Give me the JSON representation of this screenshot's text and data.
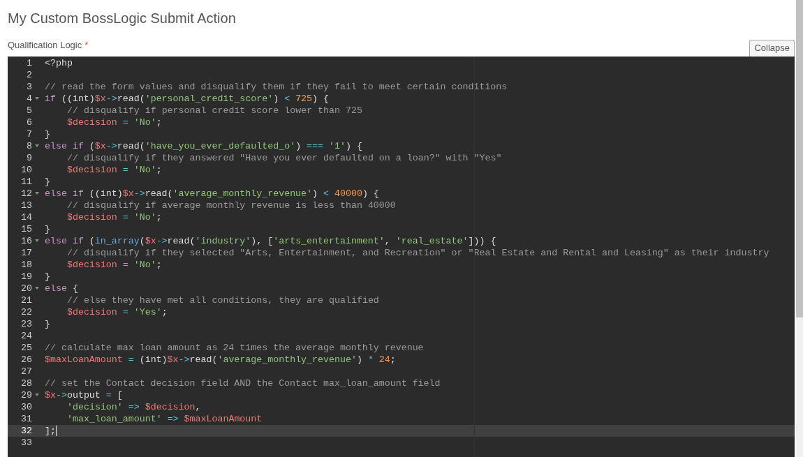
{
  "page_title": "My Custom BossLogic Submit Action",
  "field": {
    "label": "Qualification Logic",
    "required_mark": "*",
    "collapse_button": "Collapse"
  },
  "editor": {
    "lines": [
      {
        "number": "1",
        "foldable": false,
        "selected": false,
        "indent": false,
        "tokens": [
          {
            "kind": "plain",
            "text": "<?php"
          }
        ]
      },
      {
        "number": "2",
        "foldable": false,
        "selected": false,
        "indent": false
      },
      {
        "number": "3",
        "foldable": false,
        "selected": false,
        "indent": false,
        "tokens": [
          {
            "kind": "comment",
            "text": "// read the form values and disqualify them if they fail to meet certain conditions"
          }
        ]
      },
      {
        "number": "4",
        "foldable": true,
        "selected": false,
        "indent": false,
        "tokens": [
          {
            "kind": "keyword",
            "text": "if"
          },
          {
            "kind": "plain",
            "text": " ((int)"
          },
          {
            "kind": "variable",
            "text": "$x"
          },
          {
            "kind": "operator",
            "text": "->"
          },
          {
            "kind": "plain",
            "text": "read("
          },
          {
            "kind": "string",
            "text": "'personal_credit_score'"
          },
          {
            "kind": "plain",
            "text": ") "
          },
          {
            "kind": "operator",
            "text": "< "
          },
          {
            "kind": "number",
            "text": "725"
          },
          {
            "kind": "plain",
            "text": ") {"
          }
        ]
      },
      {
        "number": "5",
        "foldable": false,
        "selected": false,
        "indent": true,
        "tokens": [
          {
            "kind": "comment",
            "text": "// disqualify if personal credit score lower than 725"
          }
        ]
      },
      {
        "number": "6",
        "foldable": false,
        "selected": false,
        "indent": true,
        "tokens": [
          {
            "kind": "variable",
            "text": "$decision"
          },
          {
            "kind": "operator",
            "text": " = "
          },
          {
            "kind": "string",
            "text": "'No'"
          },
          {
            "kind": "plain",
            "text": ";"
          }
        ]
      },
      {
        "number": "7",
        "foldable": false,
        "selected": false,
        "indent": false,
        "tokens": [
          {
            "kind": "plain",
            "text": "}"
          }
        ]
      },
      {
        "number": "8",
        "foldable": true,
        "selected": false,
        "indent": false,
        "tokens": [
          {
            "kind": "keyword",
            "text": "else if"
          },
          {
            "kind": "plain",
            "text": " ("
          },
          {
            "kind": "variable",
            "text": "$x"
          },
          {
            "kind": "operator",
            "text": "->"
          },
          {
            "kind": "plain",
            "text": "read("
          },
          {
            "kind": "string",
            "text": "'have_you_ever_defaulted_o'"
          },
          {
            "kind": "plain",
            "text": ") "
          },
          {
            "kind": "operator",
            "text": "=== "
          },
          {
            "kind": "string",
            "text": "'1'"
          },
          {
            "kind": "plain",
            "text": ") {"
          }
        ]
      },
      {
        "number": "9",
        "foldable": false,
        "selected": false,
        "indent": true,
        "tokens": [
          {
            "kind": "comment",
            "text": "// disqualify if they answered \"Have you ever defaulted on a loan?\" with \"Yes\""
          }
        ]
      },
      {
        "number": "10",
        "foldable": false,
        "selected": false,
        "indent": true,
        "tokens": [
          {
            "kind": "variable",
            "text": "$decision"
          },
          {
            "kind": "operator",
            "text": " = "
          },
          {
            "kind": "string",
            "text": "'No'"
          },
          {
            "kind": "plain",
            "text": ";"
          }
        ]
      },
      {
        "number": "11",
        "foldable": false,
        "selected": false,
        "indent": false,
        "tokens": [
          {
            "kind": "plain",
            "text": "}"
          }
        ]
      },
      {
        "number": "12",
        "foldable": true,
        "selected": false,
        "indent": false,
        "tokens": [
          {
            "kind": "keyword",
            "text": "else if"
          },
          {
            "kind": "plain",
            "text": " ((int)"
          },
          {
            "kind": "variable",
            "text": "$x"
          },
          {
            "kind": "operator",
            "text": "->"
          },
          {
            "kind": "plain",
            "text": "read("
          },
          {
            "kind": "string",
            "text": "'average_monthly_revenue'"
          },
          {
            "kind": "plain",
            "text": ") "
          },
          {
            "kind": "operator",
            "text": "< "
          },
          {
            "kind": "number",
            "text": "40000"
          },
          {
            "kind": "plain",
            "text": ") {"
          }
        ]
      },
      {
        "number": "13",
        "foldable": false,
        "selected": false,
        "indent": true,
        "tokens": [
          {
            "kind": "comment",
            "text": "// disqualify if average monthly revenue is less than 40000"
          }
        ]
      },
      {
        "number": "14",
        "foldable": false,
        "selected": false,
        "indent": true,
        "tokens": [
          {
            "kind": "variable",
            "text": "$decision"
          },
          {
            "kind": "operator",
            "text": " = "
          },
          {
            "kind": "string",
            "text": "'No'"
          },
          {
            "kind": "plain",
            "text": ";"
          }
        ]
      },
      {
        "number": "15",
        "foldable": false,
        "selected": false,
        "indent": false,
        "tokens": [
          {
            "kind": "plain",
            "text": "}"
          }
        ]
      },
      {
        "number": "16",
        "foldable": true,
        "selected": false,
        "indent": false,
        "tokens": [
          {
            "kind": "keyword",
            "text": "else if"
          },
          {
            "kind": "plain",
            "text": " ("
          },
          {
            "kind": "function",
            "text": "in_array"
          },
          {
            "kind": "plain",
            "text": "("
          },
          {
            "kind": "variable",
            "text": "$x"
          },
          {
            "kind": "operator",
            "text": "->"
          },
          {
            "kind": "plain",
            "text": "read("
          },
          {
            "kind": "string",
            "text": "'industry'"
          },
          {
            "kind": "plain",
            "text": "), ["
          },
          {
            "kind": "string",
            "text": "'arts_entertainment'"
          },
          {
            "kind": "plain",
            "text": ", "
          },
          {
            "kind": "string",
            "text": "'real_estate'"
          },
          {
            "kind": "plain",
            "text": "])) {"
          }
        ]
      },
      {
        "number": "17",
        "foldable": false,
        "selected": false,
        "indent": true,
        "tokens": [
          {
            "kind": "comment",
            "text": "// disqualify if they selected \"Arts, Entertainment, and Recreation\" or \"Real Estate and Rental and Leasing\" as their industry"
          }
        ]
      },
      {
        "number": "18",
        "foldable": false,
        "selected": false,
        "indent": true,
        "tokens": [
          {
            "kind": "variable",
            "text": "$decision"
          },
          {
            "kind": "operator",
            "text": " = "
          },
          {
            "kind": "string",
            "text": "'No'"
          },
          {
            "kind": "plain",
            "text": ";"
          }
        ]
      },
      {
        "number": "19",
        "foldable": false,
        "selected": false,
        "indent": false,
        "tokens": [
          {
            "kind": "plain",
            "text": "}"
          }
        ]
      },
      {
        "number": "20",
        "foldable": true,
        "selected": false,
        "indent": false,
        "tokens": [
          {
            "kind": "keyword",
            "text": "else"
          },
          {
            "kind": "plain",
            "text": " {"
          }
        ]
      },
      {
        "number": "21",
        "foldable": false,
        "selected": false,
        "indent": true,
        "tokens": [
          {
            "kind": "comment",
            "text": "// else they have met all conditions, they are qualified"
          }
        ]
      },
      {
        "number": "22",
        "foldable": false,
        "selected": false,
        "indent": true,
        "tokens": [
          {
            "kind": "variable",
            "text": "$decision"
          },
          {
            "kind": "operator",
            "text": " = "
          },
          {
            "kind": "string",
            "text": "'Yes'"
          },
          {
            "kind": "plain",
            "text": ";"
          }
        ]
      },
      {
        "number": "23",
        "foldable": false,
        "selected": false,
        "indent": false,
        "tokens": [
          {
            "kind": "plain",
            "text": "}"
          }
        ]
      },
      {
        "number": "24",
        "foldable": false,
        "selected": false,
        "indent": false
      },
      {
        "number": "25",
        "foldable": false,
        "selected": false,
        "indent": false,
        "tokens": [
          {
            "kind": "comment",
            "text": "// calculate max loan amount as 24 times the average monthly revenue"
          }
        ]
      },
      {
        "number": "26",
        "foldable": false,
        "selected": false,
        "indent": false,
        "tokens": [
          {
            "kind": "variable",
            "text": "$maxLoanAmount"
          },
          {
            "kind": "operator",
            "text": " = "
          },
          {
            "kind": "plain",
            "text": "(int)"
          },
          {
            "kind": "variable",
            "text": "$x"
          },
          {
            "kind": "operator",
            "text": "->"
          },
          {
            "kind": "plain",
            "text": "read("
          },
          {
            "kind": "string",
            "text": "'average_monthly_revenue'"
          },
          {
            "kind": "plain",
            "text": ") "
          },
          {
            "kind": "operator",
            "text": "* "
          },
          {
            "kind": "number",
            "text": "24"
          },
          {
            "kind": "plain",
            "text": ";"
          }
        ]
      },
      {
        "number": "27",
        "foldable": false,
        "selected": false,
        "indent": false
      },
      {
        "number": "28",
        "foldable": false,
        "selected": false,
        "indent": false,
        "tokens": [
          {
            "kind": "comment",
            "text": "// set the Contact decision field AND the Contact max_loan_amount field"
          }
        ]
      },
      {
        "number": "29",
        "foldable": true,
        "selected": false,
        "indent": false,
        "tokens": [
          {
            "kind": "variable",
            "text": "$x"
          },
          {
            "kind": "operator",
            "text": "->"
          },
          {
            "kind": "plain",
            "text": "output "
          },
          {
            "kind": "operator",
            "text": "= "
          },
          {
            "kind": "plain",
            "text": "["
          }
        ]
      },
      {
        "number": "30",
        "foldable": false,
        "selected": false,
        "indent": true,
        "tokens": [
          {
            "kind": "string",
            "text": "'decision'"
          },
          {
            "kind": "operator",
            "text": " => "
          },
          {
            "kind": "variable",
            "text": "$decision"
          },
          {
            "kind": "plain",
            "text": ","
          }
        ]
      },
      {
        "number": "31",
        "foldable": false,
        "selected": false,
        "indent": true,
        "tokens": [
          {
            "kind": "string",
            "text": "'max_loan_amount'"
          },
          {
            "kind": "operator",
            "text": " => "
          },
          {
            "kind": "variable",
            "text": "$maxLoanAmount"
          }
        ]
      },
      {
        "number": "32",
        "foldable": false,
        "selected": true,
        "indent": false,
        "tokens": [
          {
            "kind": "plain",
            "text": "];"
          }
        ]
      },
      {
        "number": "33",
        "foldable": false,
        "selected": false,
        "indent": false
      }
    ]
  }
}
